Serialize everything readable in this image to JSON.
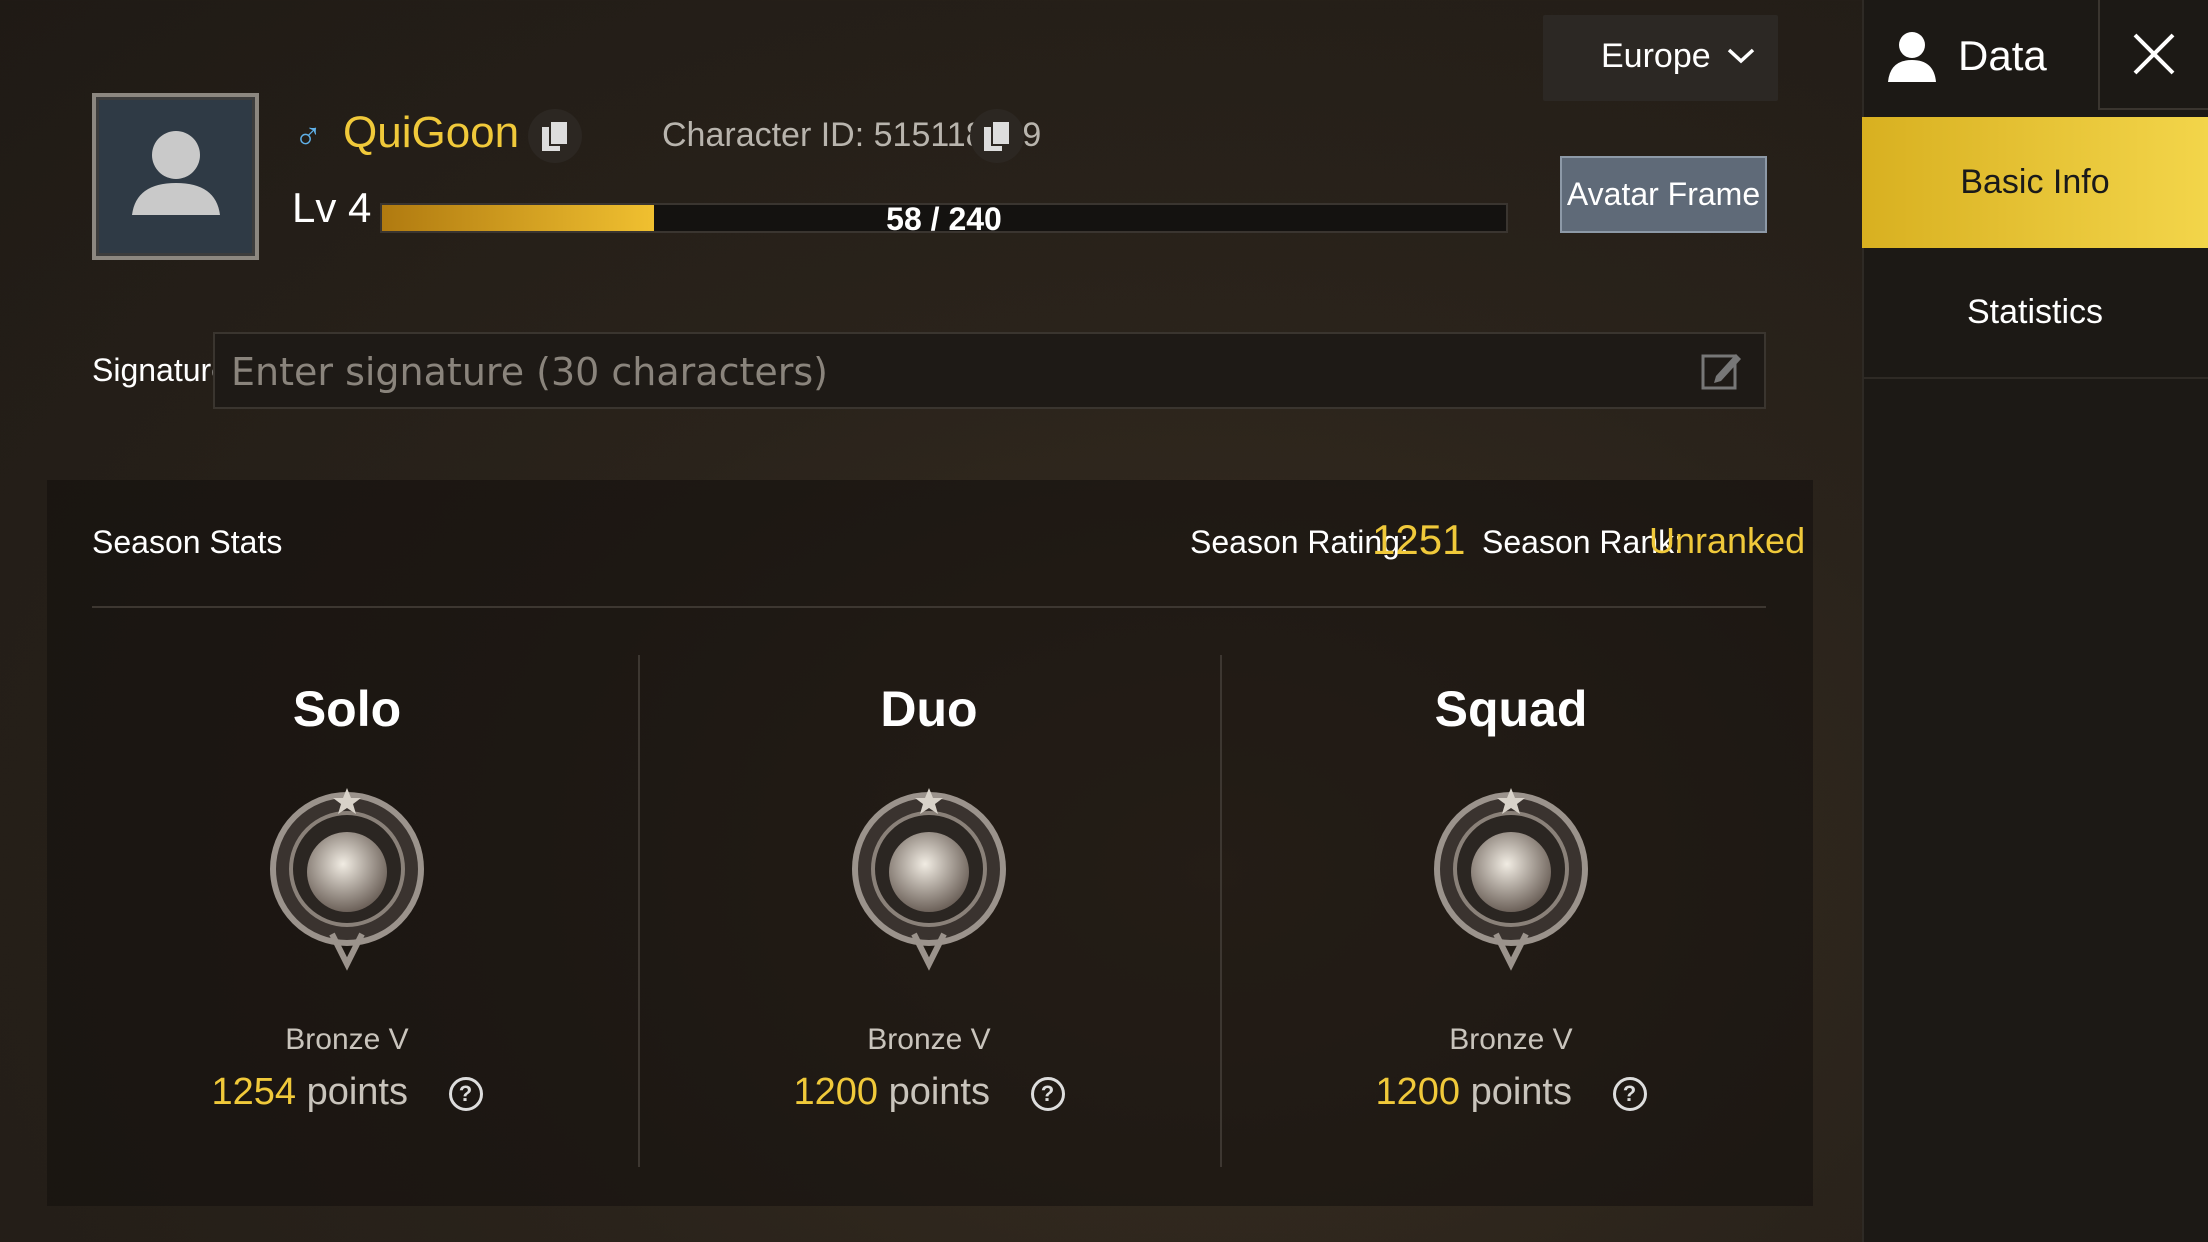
{
  "player": {
    "name": "QuiGoon",
    "gender_symbol": "♂",
    "character_id": "Character ID: 515118059",
    "level": "Lv 4",
    "xp_text": "58 / 240",
    "xp_fraction": 0.2417
  },
  "region": {
    "label": "Europe"
  },
  "buttons": {
    "avatar_frame": "Avatar Frame"
  },
  "signature": {
    "label": "Signature",
    "placeholder": "Enter signature (30 characters)",
    "value": ""
  },
  "season": {
    "title": "Season Stats",
    "rating_label": "Season Rating:",
    "rating_value": "1251",
    "rank_label": "Season Rank:",
    "rank_value": "Unranked",
    "modes": [
      {
        "name": "Solo",
        "tier": "Bronze V",
        "points": "1254",
        "points_label": "points"
      },
      {
        "name": "Duo",
        "tier": "Bronze V",
        "points": "1200",
        "points_label": "points"
      },
      {
        "name": "Squad",
        "tier": "Bronze V",
        "points": "1200",
        "points_label": "points"
      }
    ]
  },
  "sidebar": {
    "title": "Data",
    "tabs": [
      {
        "label": "Basic Info",
        "active": true
      },
      {
        "label": "Statistics",
        "active": false
      }
    ]
  },
  "colors": {
    "accent": "#f0c93a",
    "active_tab": "#e8c434"
  },
  "icons": [
    "avatar-placeholder-icon",
    "copy-icon",
    "chevron-down-icon",
    "edit-icon",
    "user-icon",
    "close-icon",
    "help-icon",
    "rank-badge-icon"
  ]
}
